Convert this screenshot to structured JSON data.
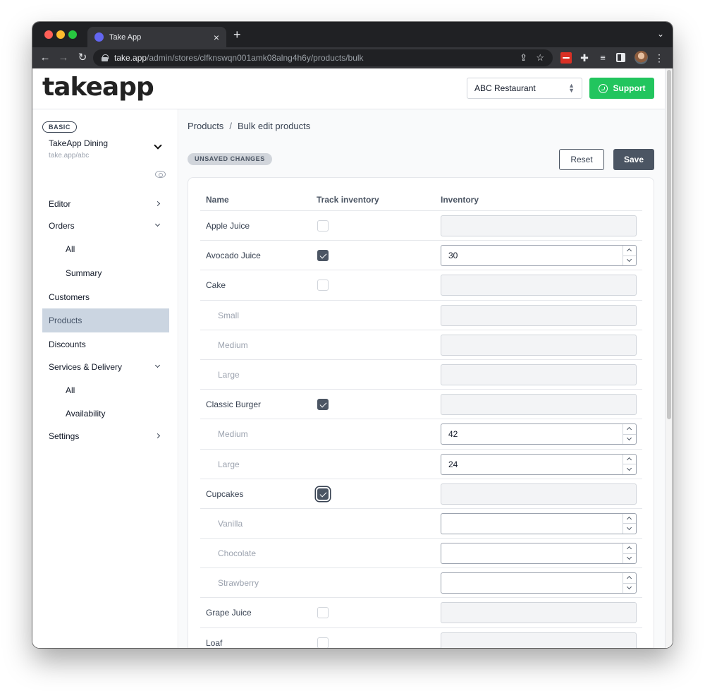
{
  "browser": {
    "tab_title": "Take App",
    "url_host": "take.app",
    "url_path": "/admin/stores/clfknswqn001amk08alng4h6y/products/bulk"
  },
  "header": {
    "logo": "takeapp",
    "store_select": "ABC Restaurant",
    "support_label": "Support",
    "support_color": "#22c55e"
  },
  "sidebar": {
    "plan": "BASIC",
    "store_name": "TakeApp Dining",
    "store_url": "take.app/abc",
    "items": [
      {
        "label": "Editor"
      },
      {
        "label": "Orders"
      },
      {
        "label": "All"
      },
      {
        "label": "Summary"
      },
      {
        "label": "Customers"
      },
      {
        "label": "Products"
      },
      {
        "label": "Discounts"
      },
      {
        "label": "Services & Delivery"
      },
      {
        "label": "All"
      },
      {
        "label": "Availability"
      },
      {
        "label": "Settings"
      }
    ]
  },
  "main": {
    "breadcrumb": {
      "parent": "Products",
      "sep": "/",
      "current": "Bulk edit products"
    },
    "unsaved": "UNSAVED CHANGES",
    "reset_label": "Reset",
    "save_label": "Save",
    "columns": {
      "name": "Name",
      "track": "Track inventory",
      "inventory": "Inventory"
    },
    "rows": [
      {
        "name": "Apple Juice",
        "inventory": ""
      },
      {
        "name": "Avocado Juice",
        "inventory": "30"
      },
      {
        "name": "Cake",
        "inventory": ""
      },
      {
        "name": "Small",
        "inventory": ""
      },
      {
        "name": "Medium",
        "inventory": ""
      },
      {
        "name": "Large",
        "inventory": ""
      },
      {
        "name": "Classic Burger",
        "inventory": ""
      },
      {
        "name": "Medium",
        "inventory": "42"
      },
      {
        "name": "Large",
        "inventory": "24"
      },
      {
        "name": "Cupcakes",
        "inventory": ""
      },
      {
        "name": "Vanilla",
        "inventory": ""
      },
      {
        "name": "Chocolate",
        "inventory": ""
      },
      {
        "name": "Strawberry",
        "inventory": ""
      },
      {
        "name": "Grape Juice",
        "inventory": ""
      },
      {
        "name": "Loaf",
        "inventory": ""
      }
    ]
  }
}
